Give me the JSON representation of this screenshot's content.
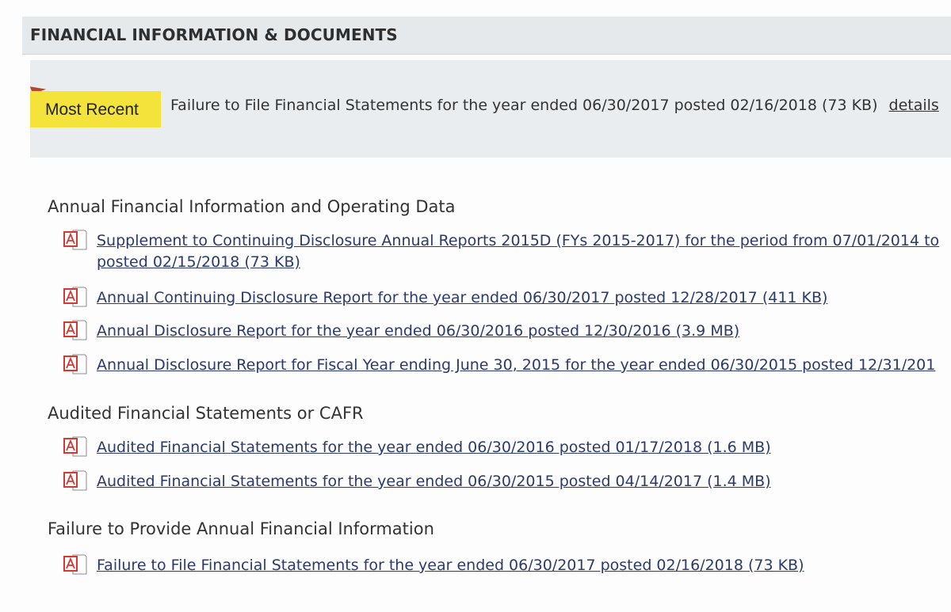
{
  "header": {
    "title": "FINANCIAL INFORMATION & DOCUMENTS"
  },
  "most_recent": {
    "badge": "Most Recent",
    "text": "Failure to File Financial Statements for the year ended 06/30/2017 posted 02/16/2018 (73 KB)",
    "details_label": "details"
  },
  "sections": [
    {
      "heading": "Annual Financial Information and Operating Data",
      "items": [
        {
          "line1": "Supplement to Continuing Disclosure Annual Reports 2015D (FYs 2015-2017) for the period from 07/01/2014 to",
          "line2": "posted 02/15/2018 (73 KB)"
        },
        {
          "line1": "Annual Continuing Disclosure Report for the year ended 06/30/2017 posted 12/28/2017 (411 KB)"
        },
        {
          "line1": "Annual Disclosure Report for the year ended 06/30/2016 posted 12/30/2016 (3.9 MB)"
        },
        {
          "line1": "Annual Disclosure Report for Fiscal Year ending June 30, 2015 for the year ended 06/30/2015 posted 12/31/201"
        }
      ]
    },
    {
      "heading": "Audited Financial Statements or CAFR",
      "items": [
        {
          "line1": "Audited Financial Statements for the year ended 06/30/2016 posted 01/17/2018 (1.6 MB)"
        },
        {
          "line1": "Audited Financial Statements for the year ended 06/30/2015 posted 04/14/2017 (1.4 MB)"
        }
      ]
    },
    {
      "heading": "Failure to Provide Annual Financial Information",
      "items": [
        {
          "line1": "Failure to File Financial Statements for the year ended 06/30/2017 posted 02/16/2018 (73 KB)"
        }
      ]
    }
  ],
  "icons": {
    "document": "pdf-icon"
  },
  "colors": {
    "badge": "#f4e33a",
    "link": "#2a3a6b",
    "pdf_icon": "#d43a32",
    "header_bg": "#e6e9eb",
    "recent_bg": "#e9edf0"
  }
}
